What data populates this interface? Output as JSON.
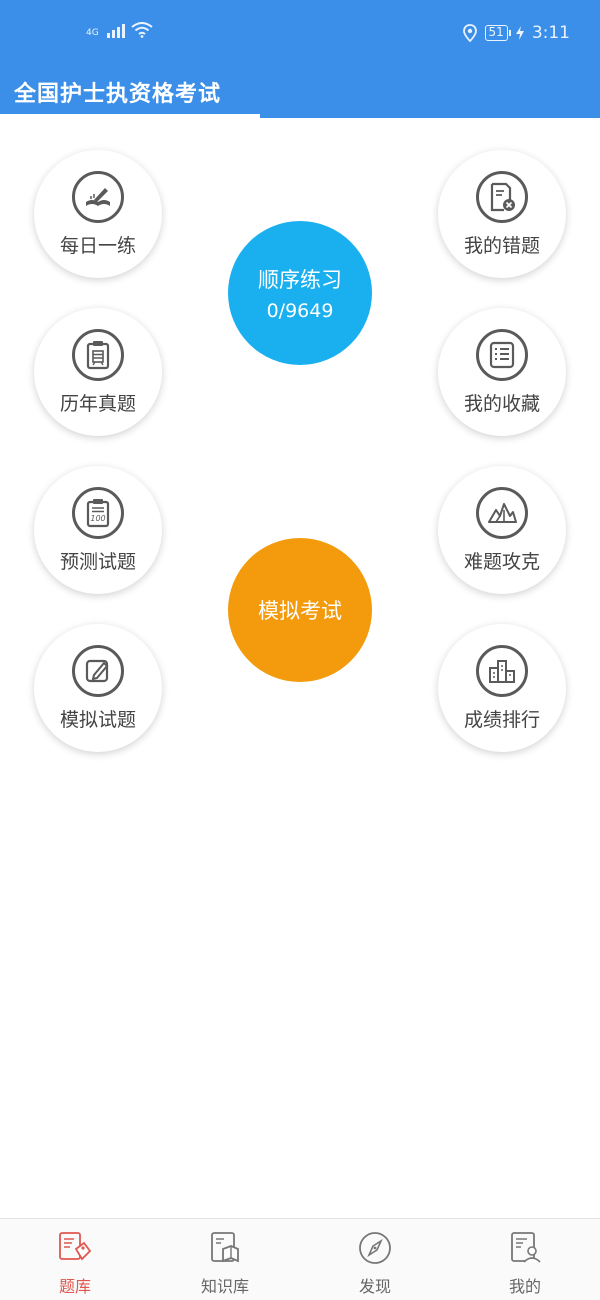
{
  "status_bar": {
    "network": "4G",
    "battery": "51",
    "time": "3:11"
  },
  "header": {
    "title": "全国护士执资格考试"
  },
  "grid": {
    "daily_practice": {
      "label": "每日一练",
      "icon": "pen-book-icon"
    },
    "past_exams": {
      "label": "历年真题",
      "icon": "clipboard-zhen-icon"
    },
    "predicted_questions": {
      "label": "预测试题",
      "icon": "clipboard-100-icon"
    },
    "mock_questions": {
      "label": "模拟试题",
      "icon": "edit-square-icon"
    },
    "my_mistakes": {
      "label": "我的错题",
      "icon": "document-x-icon"
    },
    "my_favorites": {
      "label": "我的收藏",
      "icon": "list-icon"
    },
    "hard_questions": {
      "label": "难题攻克",
      "icon": "mountain-icon"
    },
    "score_ranking": {
      "label": "成绩排行",
      "icon": "podium-icon"
    }
  },
  "sequential_practice": {
    "label": "顺序练习",
    "progress": "0/9649",
    "color": "#1ab0f0"
  },
  "mock_exam": {
    "label": "模拟考试",
    "color": "#f39a0d"
  },
  "bottom_nav": {
    "items": [
      {
        "label": "题库",
        "icon": "question-bank-icon",
        "active": true
      },
      {
        "label": "知识库",
        "icon": "knowledge-book-icon",
        "active": false
      },
      {
        "label": "发现",
        "icon": "compass-icon",
        "active": false
      },
      {
        "label": "我的",
        "icon": "profile-card-icon",
        "active": false
      }
    ]
  },
  "colors": {
    "header": "#3b8fe8",
    "active_tab": "#e0574f",
    "icon": "#5a5a5a"
  }
}
